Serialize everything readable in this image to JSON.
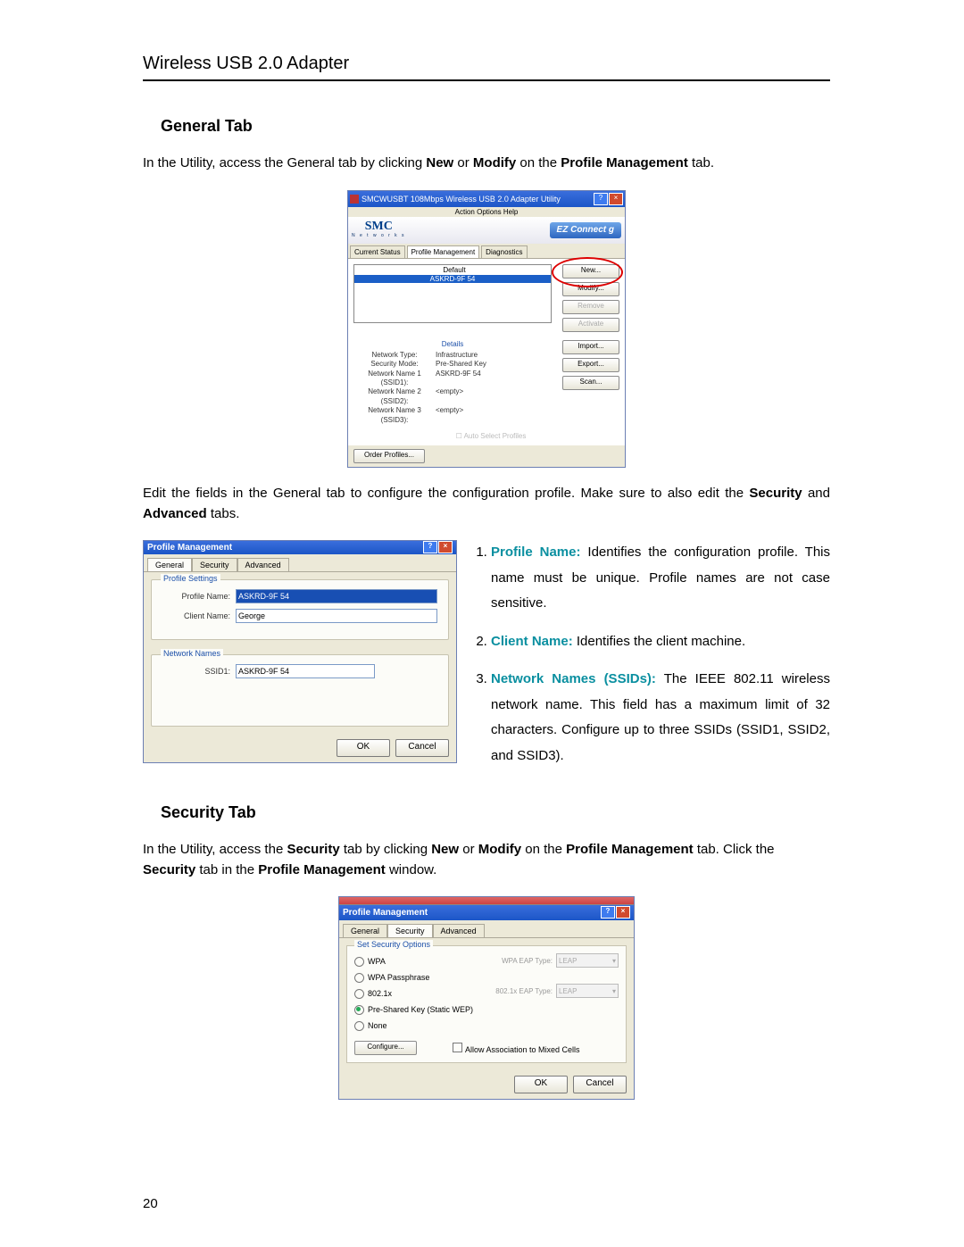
{
  "header": {
    "running": "Wireless USB 2.0 Adapter"
  },
  "section1": {
    "title": "General Tab"
  },
  "para1": {
    "pre": "In the Utility, access the General tab by clicking ",
    "b1": "New",
    "mid1": " or ",
    "b2": "Modify",
    "mid2": " on the ",
    "b3": "Profile Management",
    "post": " tab."
  },
  "ss1": {
    "title": "SMCWUSBT 108Mbps Wireless USB 2.0 Adapter Utility",
    "menu": "Action   Options   Help",
    "logo": "SMC",
    "logo_sub": "N e t w o r k s",
    "ez": "EZ Connect g",
    "tabs": {
      "a": "Current Status",
      "b": "Profile Management",
      "c": "Diagnostics"
    },
    "list": {
      "default": "Default",
      "selected": "ASKRD-9F 54"
    },
    "btns": {
      "new": "New...",
      "modify": "Modify...",
      "remove": "Remove",
      "activate": "Activate",
      "import": "Import...",
      "export": "Export...",
      "scan": "Scan...",
      "order": "Order Profiles..."
    },
    "details_label": "Details",
    "details": {
      "k1": "Network Type:",
      "v1": "Infrastructure",
      "k2": "Security Mode:",
      "v2": "Pre-Shared Key",
      "k3": "Network Name 1 (SSID1):",
      "v3": "ASKRD-9F 54",
      "k4": "Network Name 2 (SSID2):",
      "v4": "<empty>",
      "k5": "Network Name 3 (SSID3):",
      "v5": "<empty>"
    },
    "auto": "Auto Select Profiles"
  },
  "para2": {
    "pre": "Edit the fields in the General tab to configure the configuration profile. Make sure to also edit the ",
    "b1": "Security",
    "mid": " and ",
    "b2": "Advanced",
    "post": " tabs."
  },
  "ss2": {
    "title": "Profile Management",
    "tabs": {
      "a": "General",
      "b": "Security",
      "c": "Advanced"
    },
    "g1": {
      "legend": "Profile Settings",
      "l1": "Profile Name:",
      "v1": "ASKRD-9F 54",
      "l2": "Client Name:",
      "v2": "George"
    },
    "g2": {
      "legend": "Network Names",
      "l1": "SSID1:",
      "v1": "ASKRD-9F 54"
    },
    "ok": "OK",
    "cancel": "Cancel"
  },
  "list": {
    "i1": {
      "label": "Profile Name:",
      "text": " Identifies the configuration profile. This name must be unique. Profile names are not case sensitive."
    },
    "i2": {
      "label": "Client Name:",
      "text": " Identifies the client machine."
    },
    "i3": {
      "label": "Network Names (SSIDs):",
      "text": " The IEEE 802.11 wireless network name. This field has a maximum limit of 32 characters. Configure up to three SSIDs (SSID1, SSID2, and SSID3)."
    }
  },
  "section2": {
    "title": "Security Tab"
  },
  "para3": {
    "pre": "In the Utility, access the ",
    "b1": "Security",
    "mid1": " tab by clicking ",
    "b2": "New",
    "mid2": " or ",
    "b3": "Modify",
    "mid3": " on the ",
    "b4": "Profile Management",
    "mid4": " tab. Click the ",
    "b5": "Security",
    "mid5": " tab in the ",
    "b6": "Profile Management",
    "post": " window."
  },
  "ss3": {
    "title": "Profile Management",
    "tabs": {
      "a": "General",
      "b": "Security",
      "c": "Advanced"
    },
    "legend": "Set Security Options",
    "opts": {
      "a": "WPA",
      "b": "WPA Passphrase",
      "c": "802.1x",
      "d": "Pre-Shared Key (Static WEP)",
      "e": "None"
    },
    "eap1_l": "WPA EAP Type:",
    "eap1_v": "LEAP",
    "eap2_l": "802.1x EAP Type:",
    "eap2_v": "LEAP",
    "configure": "Configure...",
    "mixed": "Allow Association to Mixed Cells",
    "ok": "OK",
    "cancel": "Cancel"
  },
  "page_number": "20"
}
